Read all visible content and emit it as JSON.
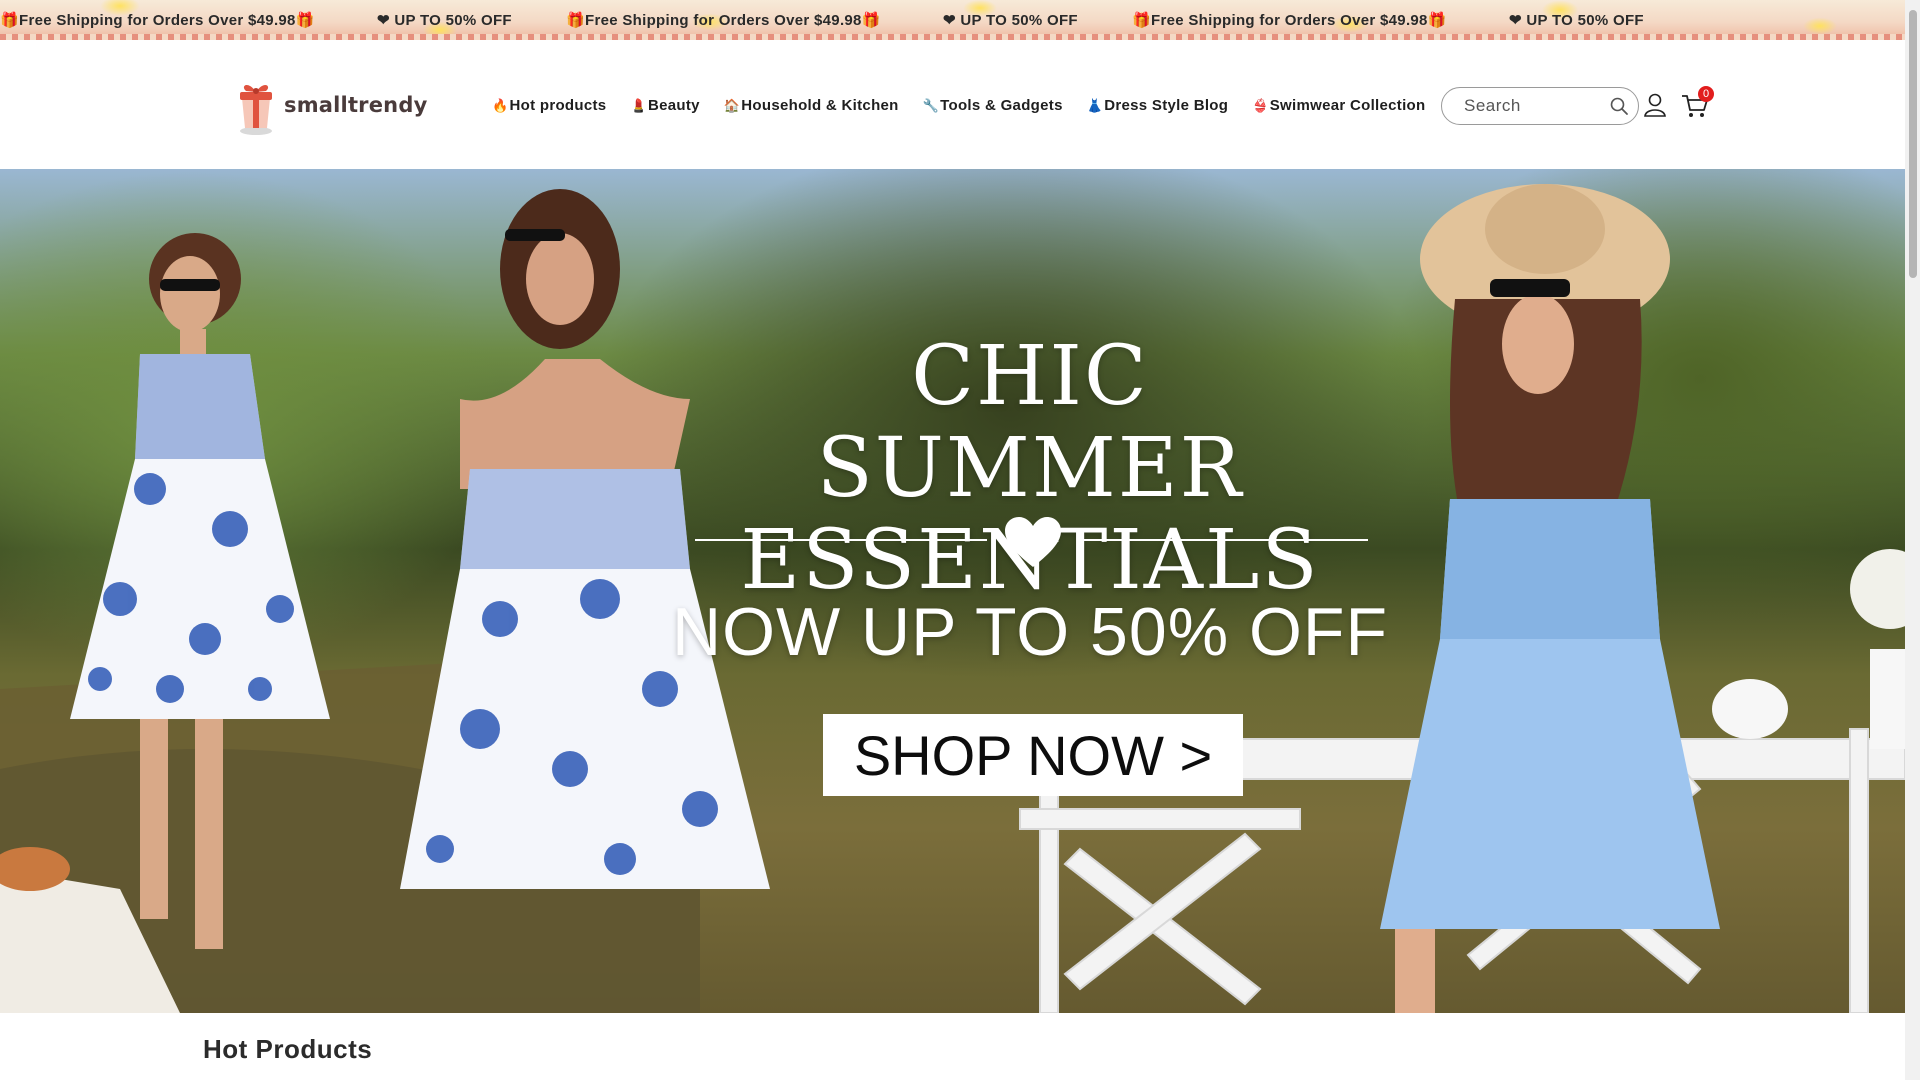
{
  "announcement": {
    "items": [
      "🎁Free Shipping for Orders Over $49.98🎁",
      "❤ UP TO 50% OFF",
      "🎁Free Shipping for Orders Over $49.98🎁",
      "❤ UP TO 50% OFF",
      "🎁Free Shipping for Orders Over $49.98🎁",
      "❤ UP TO 50% OFF"
    ]
  },
  "header": {
    "logo_text": "smalltrendy",
    "nav": [
      {
        "emoji": "🔥",
        "label": "Hot products"
      },
      {
        "emoji": "💄",
        "label": "Beauty"
      },
      {
        "emoji": "🏠",
        "label": "Household & Kitchen"
      },
      {
        "emoji": "🔧",
        "label": "Tools & Gadgets"
      },
      {
        "emoji": "👗",
        "label": "Dress Style Blog"
      },
      {
        "emoji": "👙",
        "label": "Swimwear Collection"
      }
    ],
    "search_placeholder": "Search",
    "cart_count": "0",
    "icons": {
      "search": "search-icon",
      "account": "account-icon",
      "cart": "cart-icon"
    }
  },
  "hero": {
    "title_line1": "CHIC SUMMER",
    "title_line2": "ESSENTIALS",
    "subtitle": "NOW UP TO 50% OFF",
    "cta": "SHOP NOW >"
  },
  "section": {
    "title": "Hot Products"
  },
  "colors": {
    "badge": "#e21d1d",
    "announcement_bg": "#f4d9c5",
    "text": "#1f1f1f"
  }
}
